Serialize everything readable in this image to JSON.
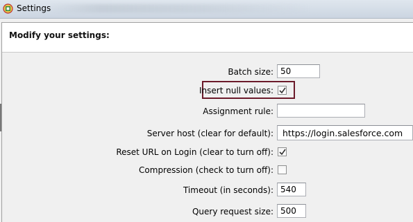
{
  "window": {
    "title": "Settings",
    "app_icon": "salesforce-dataloader-icon"
  },
  "header": {
    "title": "Modify your settings:"
  },
  "settings": [
    {
      "label": "Batch size:",
      "control": "text",
      "value": "50"
    },
    {
      "label": "Insert null values:",
      "control": "checkbox",
      "checked": true,
      "highlighted": true
    },
    {
      "label": "Assignment rule:",
      "control": "text",
      "value": ""
    },
    {
      "label": "Server host (clear for default):",
      "control": "text",
      "value": "https://login.salesforce.com"
    },
    {
      "label": "Reset URL on Login (clear to turn off):",
      "control": "checkbox",
      "checked": true
    },
    {
      "label": "Compression (check to turn off):",
      "control": "checkbox",
      "checked": false
    },
    {
      "label": "Timeout (in seconds):",
      "control": "text",
      "value": "540"
    },
    {
      "label": "Query request size:",
      "control": "text",
      "value": "500"
    }
  ],
  "colors": {
    "highlight_border": "#6b1a2a",
    "window_bg": "#f0f0f0",
    "header_bg": "#ffffff"
  }
}
